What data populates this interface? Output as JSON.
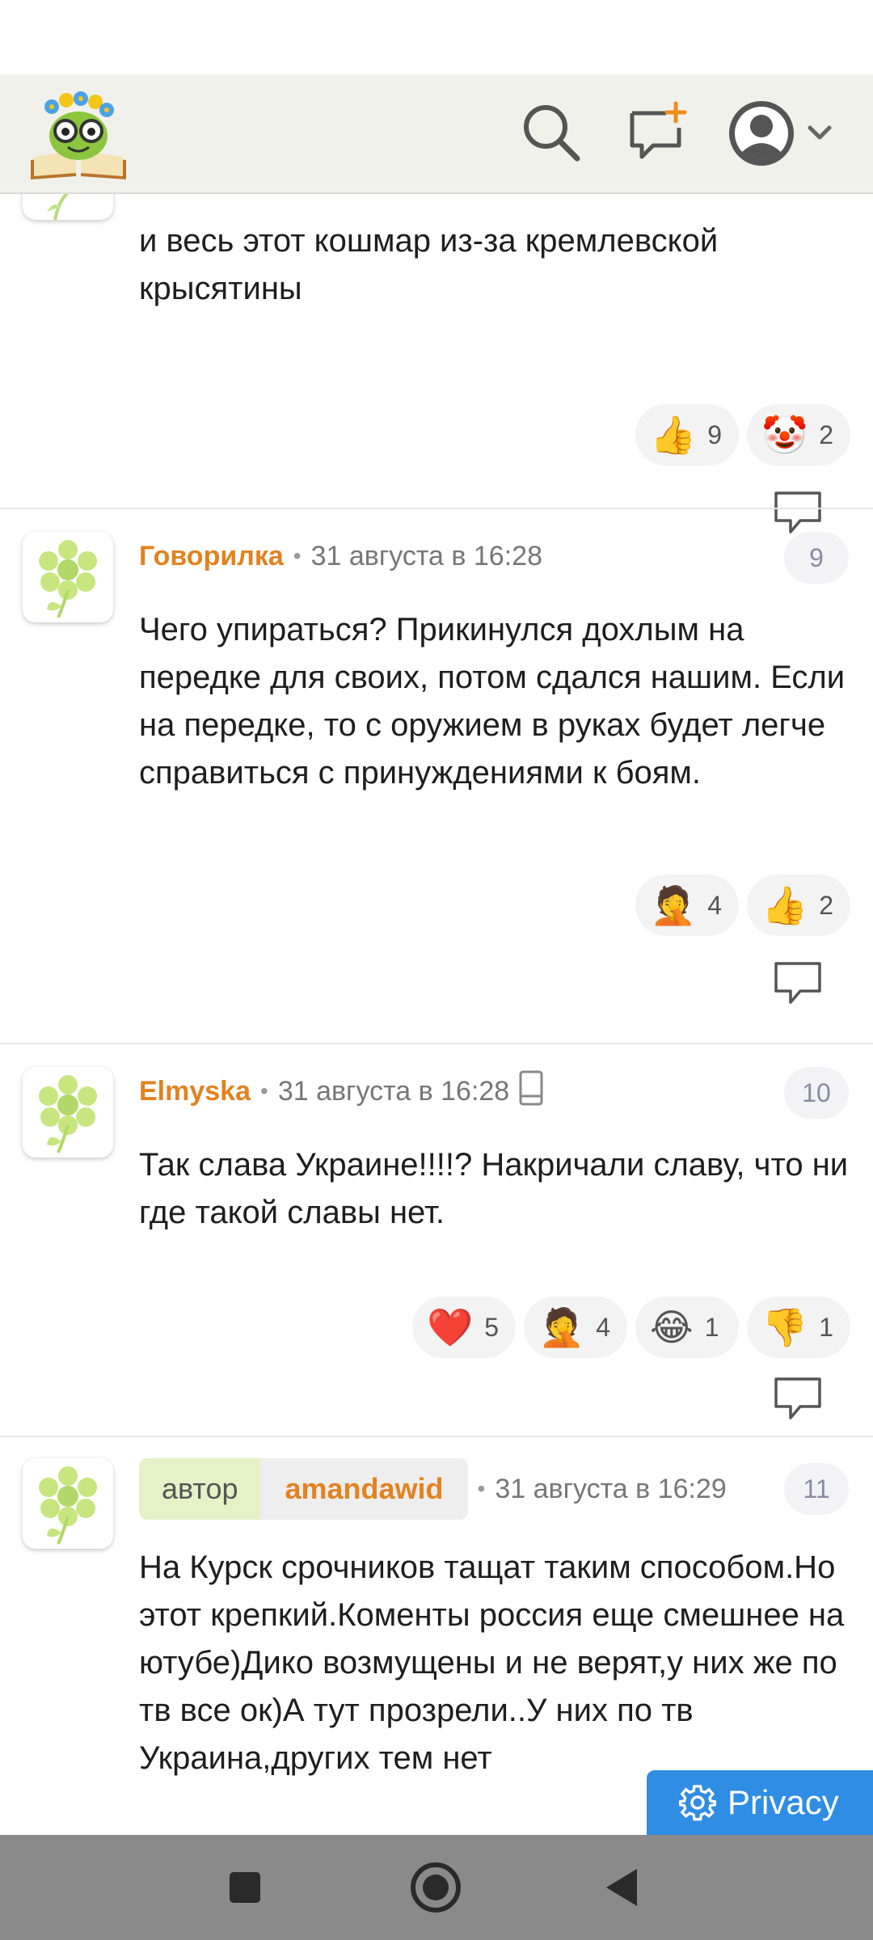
{
  "header": {
    "logo_icon": "book-bug-logo-icon",
    "search_icon": "search-icon",
    "new_post_icon": "new-message-icon",
    "profile_icon": "user-avatar-icon",
    "dropdown_icon": "chevron-down-icon"
  },
  "comments": [
    {
      "text": "и весь этот кошмар из-за кремлевской крысятины",
      "reactions": [
        {
          "emoji": "👍",
          "count": "9"
        },
        {
          "emoji": "🤡",
          "count": "2"
        }
      ]
    },
    {
      "author": "Говорилка",
      "date": "31 августа в 16:28",
      "number": "9",
      "text": "Чего упираться? Прикинулся дохлым на передке для своих, потом сдался нашим. Если на передке, то с оружием в руках будет легче справиться с принуждениями к боям.",
      "reactions": [
        {
          "emoji": "🤦",
          "count": "4"
        },
        {
          "emoji": "👍",
          "count": "2"
        }
      ]
    },
    {
      "author": "Elmyska",
      "date": "31 августа в 16:28",
      "number": "10",
      "text": "Так слава Украине!!!!? Накричали славу, что ни где такой славы нет.",
      "reactions": [
        {
          "emoji": "❤️",
          "count": "5"
        },
        {
          "emoji": "🤦",
          "count": "4"
        },
        {
          "emoji": "😂",
          "count": "1"
        },
        {
          "emoji": "👎",
          "count": "1"
        }
      ]
    },
    {
      "author_tag": "автор",
      "author": "amandawid",
      "date": "31 августа в 16:29",
      "number": "11",
      "text": "На Курск срочников тащат таким способом.Но этот крепкий.Коменты россия еще смешнее на ютубе)Дико возмущены и не верят,у них же по тв все ок)А тут прозрели..У них по тв Украина,других тем нет"
    }
  ],
  "privacy": {
    "label": "Privacy"
  },
  "colors": {
    "author": "#e3821f",
    "privacy": "#2f8de4",
    "header_bg": "#f1f1ec",
    "nav_bg": "#8a8a8a"
  }
}
